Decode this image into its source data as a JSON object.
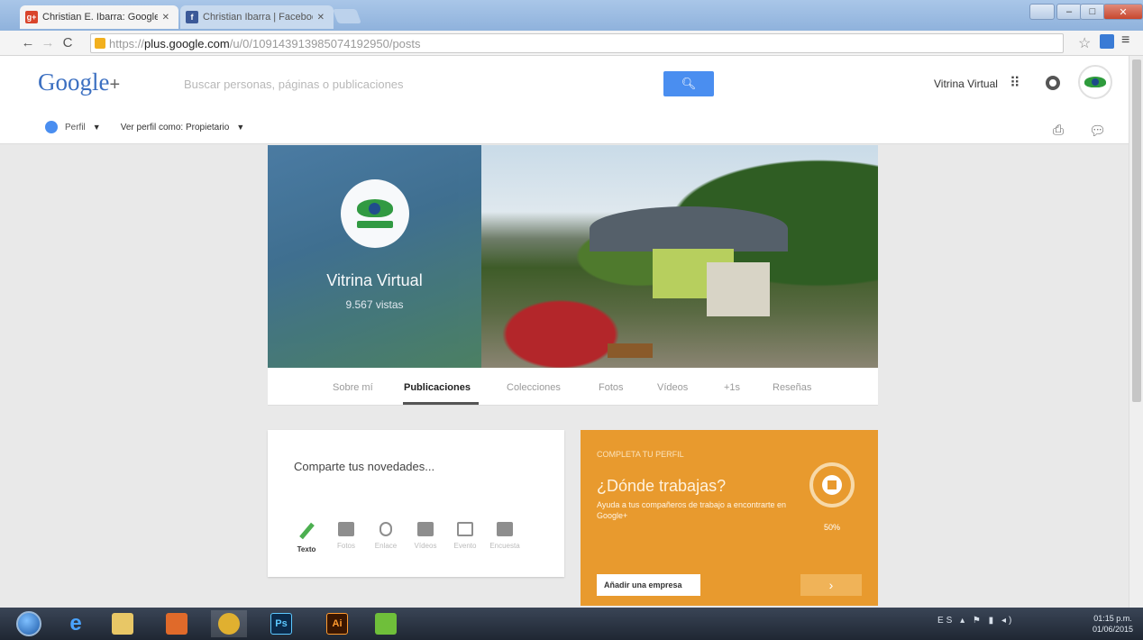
{
  "browser": {
    "tabs": [
      {
        "title": "Christian E. Ibarra: Google",
        "favicon_color": "#d9452c",
        "favicon_glyph": "g+",
        "active": true
      },
      {
        "title": "Christian Ibarra | Facebook",
        "favicon_color": "#3b5998",
        "favicon_glyph": "f",
        "active": false
      }
    ],
    "url": {
      "scheme": "https://",
      "host": "plus.google.com",
      "path": "/u/0/109143913985074192950/posts"
    }
  },
  "header": {
    "logo": "Google",
    "logo_plus": "+",
    "search_placeholder": "Buscar personas, páginas o publicaciones",
    "username": "Vitrina Virtual",
    "profile_menu": "Perfil",
    "view_as": "Ver perfil como: Propietario"
  },
  "profile": {
    "name": "Vitrina Virtual",
    "views": "9.567 vistas",
    "tabs": [
      "Sobre mí",
      "Publicaciones",
      "Colecciones",
      "Fotos",
      "Vídeos",
      "+1s",
      "Reseñas"
    ],
    "active_tab": "Publicaciones"
  },
  "share": {
    "prompt": "Comparte tus novedades...",
    "tools": [
      {
        "label": "Texto",
        "icon": "pencil-icon"
      },
      {
        "label": "Fotos",
        "icon": "camera-icon"
      },
      {
        "label": "Enlace",
        "icon": "link-icon"
      },
      {
        "label": "Vídeos",
        "icon": "video-icon"
      },
      {
        "label": "Evento",
        "icon": "calendar-icon"
      },
      {
        "label": "Encuesta",
        "icon": "poll-icon"
      }
    ]
  },
  "company_card": {
    "kicker": "COMPLETA TU PERFIL",
    "title": "¿Dónde trabajas?",
    "description": "Ayuda a tus compañeros de trabajo a encontrarte en Google+",
    "percent": "50%",
    "button": "Añadir una empresa",
    "next": "›",
    "accent": "#e89a2e"
  },
  "taskbar": {
    "apps": [
      {
        "name": "internet-explorer",
        "glyph": "e",
        "bg": "transparent",
        "fg": "#4aa3ff"
      },
      {
        "name": "file-explorer",
        "glyph": "",
        "bg": "#e8c766",
        "fg": "#fff"
      },
      {
        "name": "media-player",
        "glyph": "",
        "bg": "#e06a2a",
        "fg": "#fff"
      },
      {
        "name": "chrome",
        "glyph": "",
        "bg": "#e0b030",
        "fg": "#fff"
      },
      {
        "name": "photoshop",
        "glyph": "Ps",
        "bg": "#0b2a4a",
        "fg": "#5cc8ff"
      },
      {
        "name": "illustrator",
        "glyph": "Ai",
        "bg": "#3a1600",
        "fg": "#ff9a2e"
      },
      {
        "name": "green-app",
        "glyph": "",
        "bg": "#6fbf3a",
        "fg": "#fff"
      }
    ],
    "tray": "ES",
    "time": "01:15 p.m.",
    "date": "01/06/2015"
  }
}
